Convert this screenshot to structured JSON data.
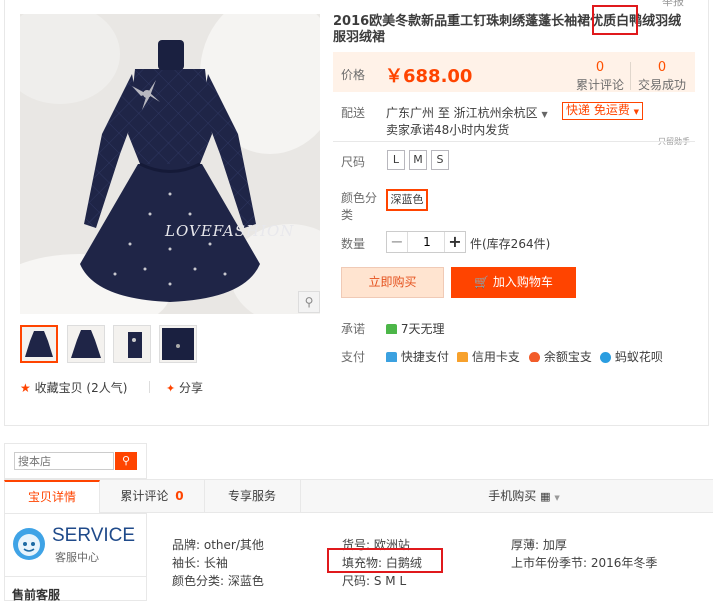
{
  "partial_top_text": "举报",
  "product": {
    "title": "2016欧美冬款新品重工钉珠刺绣蓬蓬长袖裙优质白鸭绒羽绒服羽绒裙",
    "image_watermark": "LOVEFASHION",
    "zoom_icon": "magnifier-icon"
  },
  "price": {
    "label": "价格",
    "value": "￥688.00",
    "reviews_count": "0",
    "reviews_label": "累计评论",
    "sales_count": "0",
    "sales_label": "交易成功"
  },
  "shipping": {
    "label": "配送",
    "route": "广东广州 至  浙江杭州余杭区",
    "method": "快递 免运费",
    "promise": "卖家承诺48小时内发货",
    "note": "只留勋手"
  },
  "size": {
    "label": "尺码",
    "options": [
      "L",
      "M",
      "S"
    ]
  },
  "color": {
    "label": "颜色分类",
    "selected": "深蓝色"
  },
  "quantity": {
    "label": "数量",
    "value": "1",
    "stock": "件(库存264件)"
  },
  "actions": {
    "buy_now": "立即购买",
    "add_to_cart": "加入购物车"
  },
  "promise": {
    "label": "承诺",
    "item": "7天无理由"
  },
  "payment": {
    "label": "支付",
    "methods": [
      "快捷支付",
      "信用卡支付",
      "余额宝支付",
      "蚂蚁花呗"
    ]
  },
  "social": {
    "favorite": "收藏宝贝 (2人气)",
    "share": "分享"
  },
  "store": {
    "search_placeholder": "搜本店"
  },
  "tabs": {
    "details": "宝贝详情",
    "reviews": "累计评论",
    "reviews_count": "0",
    "services": "专享服务",
    "mobile": "手机购买"
  },
  "service": {
    "title": "SERVICE",
    "subtitle": "客服中心",
    "presale": "售前客服"
  },
  "attributes": {
    "brand": "品牌: other/其他",
    "sleeve": "袖长: 长袖",
    "color_class": "颜色分类: 深蓝色",
    "item_no": "货号: 欧洲站",
    "filling": "填充物: 白鹅绒",
    "size": "尺码: S M L",
    "thickness": "厚薄: 加厚",
    "season": "上市年份季节: 2016年冬季"
  },
  "colors": {
    "accent": "#ff4400",
    "price_bg": "#fff2e8",
    "annotation": "#e0191c",
    "dress": "#1f2547"
  }
}
